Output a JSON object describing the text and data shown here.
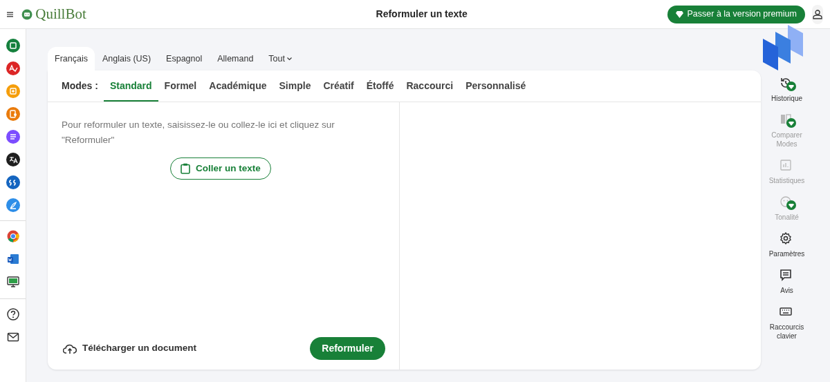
{
  "header": {
    "brand": "QuillBot",
    "title": "Reformuler un texte",
    "premium_button": "Passer à la version premium"
  },
  "sidebar": {
    "groups": [
      [
        {
          "kind": "paraphrase",
          "color": "#15803d"
        },
        {
          "kind": "grammar",
          "color": "#dc2626"
        },
        {
          "kind": "detector",
          "color": "#f59e0b"
        },
        {
          "kind": "plagiarism",
          "color": "#ea7b0c"
        },
        {
          "kind": "summarizer",
          "color": "#7c4dff"
        },
        {
          "kind": "translator",
          "color": "#1f1f1f"
        },
        {
          "kind": "citation",
          "color": "#1565c0"
        },
        {
          "kind": "cowriter",
          "color": "#2e8ee8"
        }
      ],
      [
        {
          "kind": "chrome"
        },
        {
          "kind": "word"
        },
        {
          "kind": "desktop"
        }
      ],
      [
        {
          "kind": "help"
        },
        {
          "kind": "mail"
        }
      ]
    ]
  },
  "languages": [
    {
      "label": "Français",
      "selected": true
    },
    {
      "label": "Anglais (US)",
      "selected": false
    },
    {
      "label": "Espagnol",
      "selected": false
    },
    {
      "label": "Allemand",
      "selected": false
    },
    {
      "label": "Tout",
      "selected": false,
      "dropdown": true
    }
  ],
  "modes_label": "Modes :",
  "modes": [
    {
      "label": "Standard",
      "selected": true
    },
    {
      "label": "Formel",
      "selected": false
    },
    {
      "label": "Académique",
      "selected": false
    },
    {
      "label": "Simple",
      "selected": false
    },
    {
      "label": "Créatif",
      "selected": false
    },
    {
      "label": "Étoffé",
      "selected": false
    },
    {
      "label": "Raccourci",
      "selected": false
    },
    {
      "label": "Personnalisé",
      "selected": false
    }
  ],
  "input": {
    "placeholder": "Pour reformuler un texte, saisissez-le ou collez-le ici et cliquez sur \"Reformuler\""
  },
  "paste_button": "Coller un texte",
  "upload_link": "Télécharger un document",
  "submit_button": "Reformuler",
  "tools": [
    {
      "kind": "history",
      "label": "Historique",
      "disabled": false,
      "premium": true
    },
    {
      "kind": "compare",
      "label": "Comparer Modes",
      "disabled": true,
      "premium": true
    },
    {
      "kind": "stats",
      "label": "Statistiques",
      "disabled": true,
      "premium": false
    },
    {
      "kind": "tone",
      "label": "Tonalité",
      "disabled": true,
      "premium": true
    },
    {
      "kind": "settings",
      "label": "Paramètres",
      "disabled": false,
      "premium": false
    },
    {
      "kind": "feedback",
      "label": "Avis",
      "disabled": false,
      "premium": false
    },
    {
      "kind": "keyboard",
      "label": "Raccourcis clavier",
      "disabled": false,
      "premium": false
    }
  ]
}
